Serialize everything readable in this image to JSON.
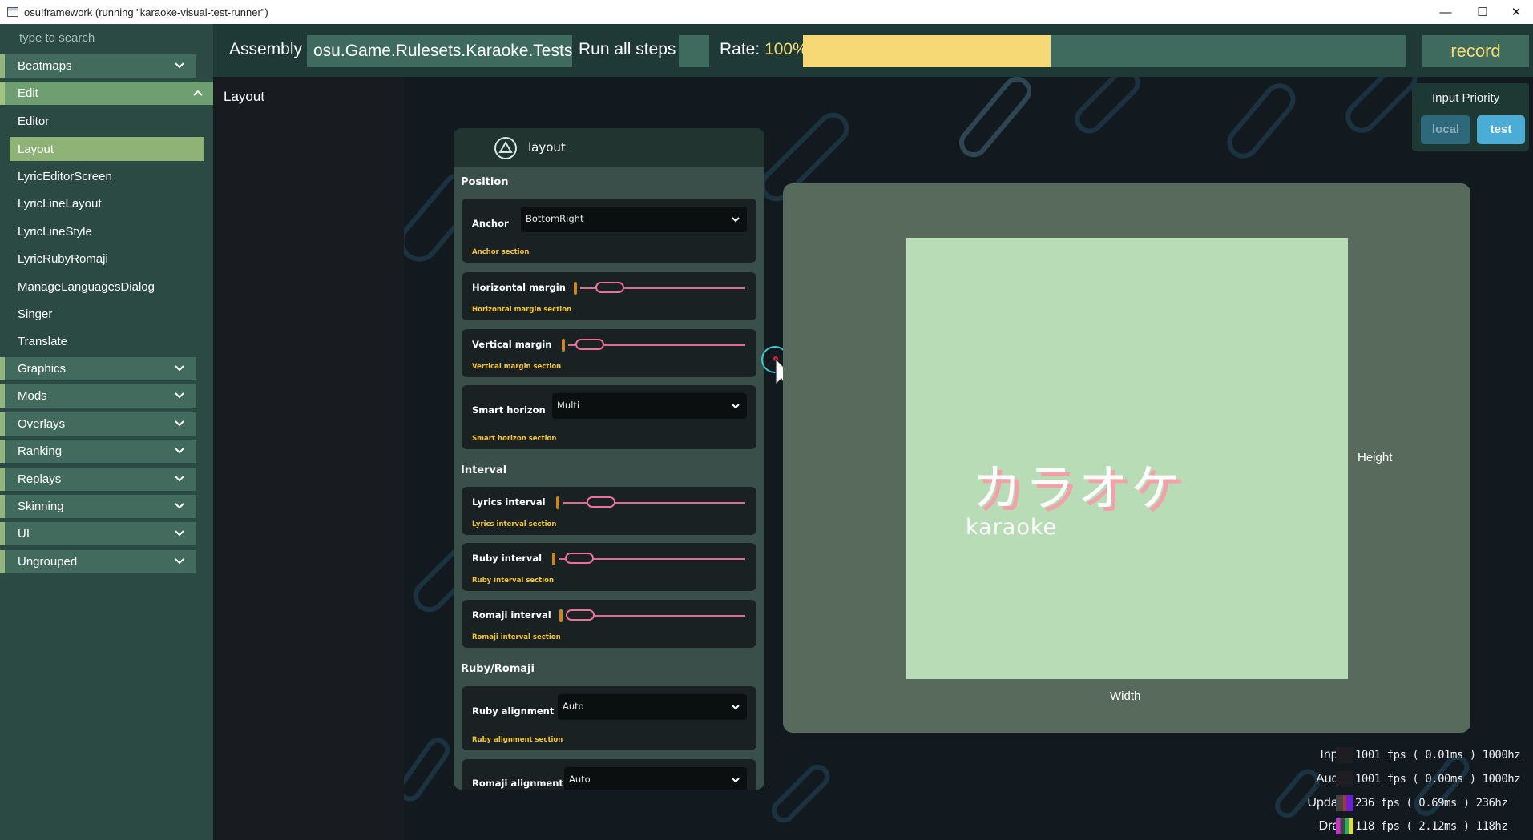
{
  "window": {
    "title": "osu!framework (running \"karaoke-visual-test-runner\")",
    "minimize": "—",
    "maximize": "☐",
    "close": "✕"
  },
  "sidebar": {
    "search_placeholder": "type to search",
    "groups": {
      "beatmaps": "Beatmaps",
      "edit": "Edit",
      "graphics": "Graphics",
      "mods": "Mods",
      "overlays": "Overlays",
      "ranking": "Ranking",
      "replays": "Replays",
      "skinning": "Skinning",
      "ui": "UI",
      "ungrouped": "Ungrouped"
    },
    "edit_items": [
      "Editor",
      "Layout",
      "LyricEditorScreen",
      "LyricLineLayout",
      "LyricLineStyle",
      "LyricRubyRomaji",
      "ManageLanguagesDialog",
      "Singer",
      "Translate"
    ],
    "active_item": "Layout"
  },
  "topbar": {
    "assembly_label": "Assembly",
    "assembly_value": "osu.Game.Rulesets.Karaoke.Tests",
    "run_all_steps": "Run all steps",
    "rate_label": "Rate:",
    "rate_value": "100%",
    "rate_fill_fraction": 0.41,
    "record": "record"
  },
  "test_title": "Layout",
  "panel": {
    "title": "layout",
    "sections": {
      "position": "Position",
      "interval": "Interval",
      "ruby_romaji": "Ruby/Romaji"
    },
    "anchor": {
      "label": "Anchor",
      "value": "BottomRight",
      "sub": "Anchor section"
    },
    "horizontal_margin": {
      "label": "Horizontal margin",
      "sub": "Horizontal margin section"
    },
    "vertical_margin": {
      "label": "Vertical margin",
      "sub": "Vertical margin section"
    },
    "smart_horizon": {
      "label": "Smart horizon",
      "value": "Multi",
      "sub": "Smart horizon section"
    },
    "lyrics_interval": {
      "label": "Lyrics interval",
      "sub": "Lyrics interval section"
    },
    "ruby_interval": {
      "label": "Ruby interval",
      "sub": "Ruby interval section"
    },
    "romaji_interval": {
      "label": "Romaji interval",
      "sub": "Romaji interval section"
    },
    "ruby_alignment": {
      "label": "Ruby alignment",
      "value": "Auto",
      "sub": "Ruby alignment section"
    },
    "romaji_alignment": {
      "label": "Romaji alignment",
      "value": "Auto"
    }
  },
  "preview": {
    "lyric": "カラオケ",
    "romaji": "karaoke",
    "height_label": "Height",
    "width_label": "Width"
  },
  "input_priority": {
    "title": "Input Priority",
    "local": "local",
    "test": "test"
  },
  "perf": [
    {
      "name": "Input",
      "value": "1001 fps ( 0.01ms ) 1000hz"
    },
    {
      "name": "Audio",
      "value": "1001 fps ( 0.00ms ) 1000hz"
    },
    {
      "name": "Update",
      "value": "236 fps ( 0.69ms ) 236hz"
    },
    {
      "name": "Draw",
      "value": "118 fps ( 2.12ms ) 118hz"
    }
  ],
  "colors": {
    "accent_yellow": "#f6d974",
    "sidebar_bg": "#2b4a43",
    "slider_pink": "#ef6f97",
    "preview_bg": "#586a5c",
    "preview_inner": "#b8dcb6",
    "test_button": "#4fb4e0"
  }
}
